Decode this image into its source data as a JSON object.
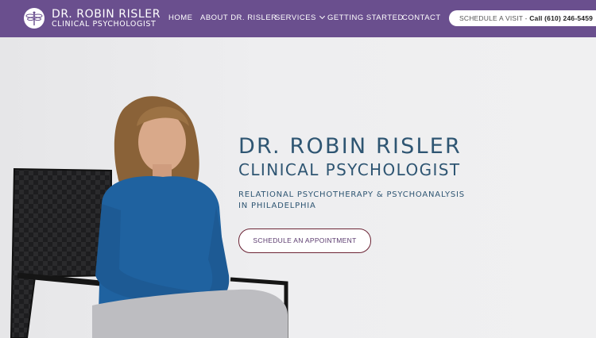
{
  "header": {
    "brand_name": "DR. ROBIN RISLER",
    "brand_subtitle": "CLINICAL PSYCHOLOGIST",
    "logo_icon": "dragonfly-icon",
    "nav": {
      "home": "HOME",
      "about": "ABOUT DR. RISLER",
      "services": "SERVICES",
      "getting_started": "GETTING STARTED",
      "contact": "CONTACT"
    },
    "visit_label": "SCHEDULE A VISIT - ",
    "visit_phone": "Call (610) 246-5459"
  },
  "hero": {
    "title": "DR. ROBIN RISLER",
    "subtitle": "CLINICAL PSYCHOLOGIST",
    "tagline_line1": "RELATIONAL PSYCHOTHERAPY & PSYCHOANALYSIS",
    "tagline_line2": "IN PHILADELPHIA",
    "cta_label": "SCHEDULE AN APPOINTMENT"
  },
  "colors": {
    "header_bg": "#6a4f8e",
    "heading_text": "#2e5572",
    "cta_border": "#6b2334",
    "background": "#eeeef0"
  }
}
